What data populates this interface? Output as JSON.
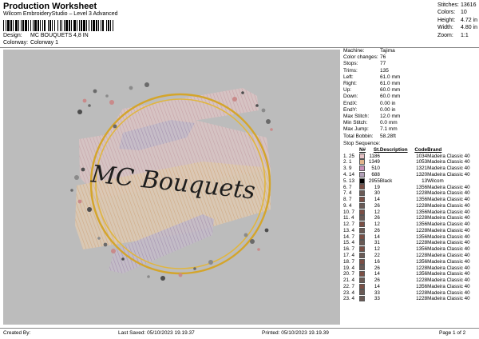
{
  "header": {
    "title": "Production Worksheet",
    "subtitle": "Wilcom EmbroideryStudio – Level 3 Advanced",
    "design_label": "Design:",
    "design_value": "MC BOUQUETS 4,8 IN",
    "colorway_label": "Colorway:",
    "colorway_value": "Colorway 1"
  },
  "stats": [
    {
      "label": "Stitches:",
      "value": "13616"
    },
    {
      "label": "Colors:",
      "value": "10"
    },
    {
      "label": "Height:",
      "value": "4.72 in"
    },
    {
      "label": "Width:",
      "value": "4.80 in"
    },
    {
      "label": "Zoom:",
      "value": "1:1"
    }
  ],
  "design_preview": {
    "text": "MC Bouquets",
    "ring_color": "#d4a52a",
    "text_color": "#1e1e1e"
  },
  "machine_info": [
    {
      "label": "Machine:",
      "value": "Tajima"
    },
    {
      "label": "Color changes:",
      "value": "76"
    },
    {
      "label": "Stops:",
      "value": "77"
    },
    {
      "label": "Trims:",
      "value": "135"
    },
    {
      "label": "Left:",
      "value": "61.0 mm"
    },
    {
      "label": "Right:",
      "value": "61.0 mm"
    },
    {
      "label": "Up:",
      "value": "60.0 mm"
    },
    {
      "label": "Down:",
      "value": "60.0 mm"
    },
    {
      "label": "EndX:",
      "value": "0.00 in"
    },
    {
      "label": "EndY:",
      "value": "0.00 in"
    },
    {
      "label": "Max Stitch:",
      "value": "12.0 mm"
    },
    {
      "label": "Min Stitch:",
      "value": "0.0 mm"
    },
    {
      "label": "Max Jump:",
      "value": "7.1 mm"
    },
    {
      "label": "Total Bobbin:",
      "value": "58.28ft"
    }
  ],
  "stop_sequence": {
    "title": "Stop Sequence:",
    "headers": [
      "N#",
      "St.",
      "Description",
      "Code",
      "Brand"
    ],
    "rows": [
      {
        "stop": "1.",
        "n": "25",
        "color": "#e6c2c5",
        "st": "1186",
        "desc": "",
        "code": "1034",
        "brand": "Madeira Classic 40"
      },
      {
        "stop": "2.",
        "n": "1",
        "color": "#e2b58c",
        "st": "1349",
        "desc": "",
        "code": "1053",
        "brand": "Madeira Classic 40"
      },
      {
        "stop": "3.",
        "n": "9",
        "color": "#c78fb5",
        "st": "510",
        "desc": "",
        "code": "1321",
        "brand": "Madeira Classic 40"
      },
      {
        "stop": "4.",
        "n": "14",
        "color": "#b2a0b8",
        "st": "688",
        "desc": "",
        "code": "1320",
        "brand": "Madeira Classic 40"
      },
      {
        "stop": "5.",
        "n": "13",
        "color": "#000000",
        "st": "2955",
        "desc": "Black",
        "code": "13",
        "brand": "Wilcom"
      },
      {
        "stop": "6.",
        "n": "7",
        "color": "#7a4f45",
        "st": "19",
        "desc": "",
        "code": "1356",
        "brand": "Madeira Classic 40"
      },
      {
        "stop": "7.",
        "n": "4",
        "color": "#6a5a55",
        "st": "30",
        "desc": "",
        "code": "1228",
        "brand": "Madeira Classic 40"
      },
      {
        "stop": "8.",
        "n": "7",
        "color": "#7a4f45",
        "st": "14",
        "desc": "",
        "code": "1356",
        "brand": "Madeira Classic 40"
      },
      {
        "stop": "9.",
        "n": "4",
        "color": "#6a5a55",
        "st": "26",
        "desc": "",
        "code": "1228",
        "brand": "Madeira Classic 40"
      },
      {
        "stop": "10.",
        "n": "7",
        "color": "#7a4f45",
        "st": "12",
        "desc": "",
        "code": "1356",
        "brand": "Madeira Classic 40"
      },
      {
        "stop": "11.",
        "n": "4",
        "color": "#6a5a55",
        "st": "26",
        "desc": "",
        "code": "1228",
        "brand": "Madeira Classic 40"
      },
      {
        "stop": "12.",
        "n": "7",
        "color": "#7a4f45",
        "st": "12",
        "desc": "",
        "code": "1356",
        "brand": "Madeira Classic 40"
      },
      {
        "stop": "13.",
        "n": "4",
        "color": "#6a5a55",
        "st": "26",
        "desc": "",
        "code": "1228",
        "brand": "Madeira Classic 40"
      },
      {
        "stop": "14.",
        "n": "7",
        "color": "#7a4f45",
        "st": "14",
        "desc": "",
        "code": "1356",
        "brand": "Madeira Classic 40"
      },
      {
        "stop": "15.",
        "n": "4",
        "color": "#6a5a55",
        "st": "31",
        "desc": "",
        "code": "1228",
        "brand": "Madeira Classic 40"
      },
      {
        "stop": "16.",
        "n": "7",
        "color": "#7a4f45",
        "st": "12",
        "desc": "",
        "code": "1356",
        "brand": "Madeira Classic 40"
      },
      {
        "stop": "17.",
        "n": "4",
        "color": "#6a5a55",
        "st": "22",
        "desc": "",
        "code": "1228",
        "brand": "Madeira Classic 40"
      },
      {
        "stop": "18.",
        "n": "7",
        "color": "#7a4f45",
        "st": "16",
        "desc": "",
        "code": "1356",
        "brand": "Madeira Classic 40"
      },
      {
        "stop": "19.",
        "n": "4",
        "color": "#6a5a55",
        "st": "26",
        "desc": "",
        "code": "1228",
        "brand": "Madeira Classic 40"
      },
      {
        "stop": "20.",
        "n": "7",
        "color": "#7a4f45",
        "st": "14",
        "desc": "",
        "code": "1356",
        "brand": "Madeira Classic 40"
      },
      {
        "stop": "21.",
        "n": "4",
        "color": "#6a5a55",
        "st": "26",
        "desc": "",
        "code": "1228",
        "brand": "Madeira Classic 40"
      },
      {
        "stop": "22.",
        "n": "7",
        "color": "#7a4f45",
        "st": "14",
        "desc": "",
        "code": "1356",
        "brand": "Madeira Classic 40"
      },
      {
        "stop": "23.",
        "n": "4",
        "color": "#6a5a55",
        "st": "33",
        "desc": "",
        "code": "1228",
        "brand": "Madeira Classic 40"
      },
      {
        "stop": "23.",
        "n": "4",
        "color": "#6a5a55",
        "st": "33",
        "desc": "",
        "code": "1228",
        "brand": "Madeira Classic 40"
      }
    ]
  },
  "footer": {
    "created_by": "Created By:",
    "last_saved": "Last Saved: 05/10/2023 19.19.37",
    "printed": "Printed: 05/10/2023 19.19.39",
    "page": "Page 1 of 2"
  }
}
